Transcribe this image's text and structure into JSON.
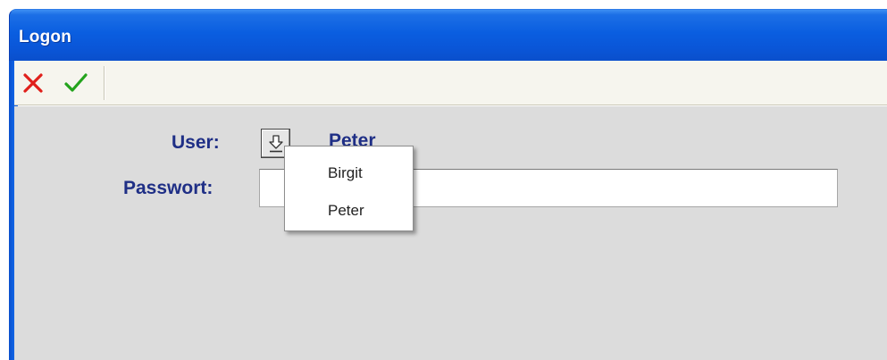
{
  "window": {
    "title": "Logon"
  },
  "toolbar": {
    "cancel_icon": "x-icon",
    "ok_icon": "check-icon"
  },
  "form": {
    "user_label": "User:",
    "user_value": "Peter",
    "password_label": "Passwort:",
    "password_value": "",
    "dropdown_icon": "arrow-down-icon"
  },
  "user_popup": {
    "items": [
      {
        "label": "Birgit"
      },
      {
        "label": "Peter"
      }
    ]
  },
  "colors": {
    "title_bar": "#0a5ee0",
    "label_text": "#1f2f86",
    "cancel_icon": "#e0201b",
    "ok_icon": "#23a31c",
    "client_background": "#dcdcdc"
  }
}
